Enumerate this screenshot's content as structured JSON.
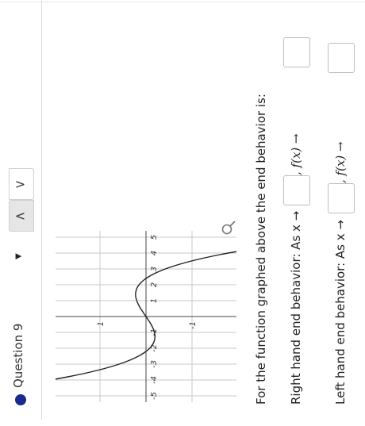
{
  "question": {
    "dot_color": "#1a2a8a",
    "label": "Question 9",
    "caret": "▼",
    "nav_up": "<",
    "nav_down": ">"
  },
  "graph": {
    "x_ticks": [
      "-5",
      "-4",
      "-3",
      "-2",
      "-1",
      "1",
      "2",
      "3",
      "4",
      "5"
    ],
    "y_ticks": [
      "1",
      "-1"
    ],
    "zoom_icon": "magnifier-icon"
  },
  "prompt": {
    "intro": "For the function graphed above the end behavior is:",
    "right_pre": "Right hand end behavior: As x →",
    "right_mid": ", f(x) →",
    "left_pre": "Left hand end behavior: As x →",
    "left_mid": ", f(x) →",
    "right_box1": "",
    "right_box2": "",
    "left_box1": "",
    "left_box2": ""
  }
}
